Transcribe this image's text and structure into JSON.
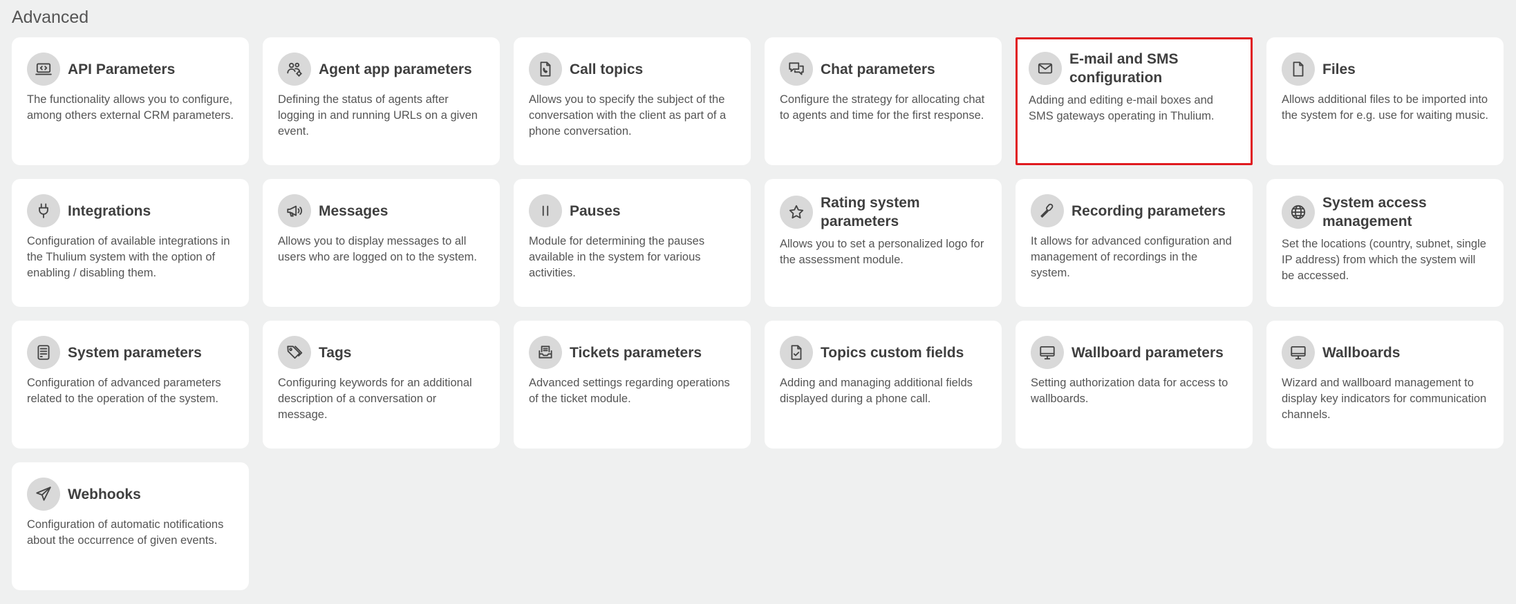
{
  "section": {
    "title": "Advanced"
  },
  "cards": [
    {
      "title": "API Parameters",
      "description": "The functionality allows you to configure, among others external CRM parameters.",
      "icon": "api-icon"
    },
    {
      "title": "Agent app parameters",
      "description": "Defining the status of agents after logging in and running URLs on a given event.",
      "icon": "agents-gear-icon"
    },
    {
      "title": "Call topics",
      "description": "Allows you to specify the subject of the conversation with the client as part of a phone conversation.",
      "icon": "document-phone-icon"
    },
    {
      "title": "Chat parameters",
      "description": "Configure the strategy for allocating chat to agents and time for the first response.",
      "icon": "chat-bubbles-icon"
    },
    {
      "title": "E-mail and SMS configuration",
      "description": "Adding and editing e-mail boxes and SMS gateways operating in Thulium.",
      "icon": "envelope-icon",
      "highlighted": true
    },
    {
      "title": "Files",
      "description": "Allows additional files to be imported into the system for e.g. use for waiting music.",
      "icon": "file-icon"
    },
    {
      "title": "Integrations",
      "description": "Configuration of available integrations in the Thulium system with the option of enabling / disabling them.",
      "icon": "plug-icon"
    },
    {
      "title": "Messages",
      "description": "Allows you to display messages to all users who are logged on to the system.",
      "icon": "megaphone-icon"
    },
    {
      "title": "Pauses",
      "description": "Module for determining the pauses available in the system for various activities.",
      "icon": "pause-icon"
    },
    {
      "title": "Rating system parameters",
      "description": "Allows you to set a personalized logo for the assessment module.",
      "icon": "star-icon"
    },
    {
      "title": "Recording parameters",
      "description": "It allows for advanced configuration and management of recordings in the system.",
      "icon": "microphone-icon"
    },
    {
      "title": "System access management",
      "description": "Set the locations (country, subnet, single IP address) from which the system will be accessed.",
      "icon": "globe-icon"
    },
    {
      "title": "System parameters",
      "description": "Configuration of advanced parameters related to the operation of the system.",
      "icon": "server-icon"
    },
    {
      "title": "Tags",
      "description": "Configuring keywords for an additional description of a conversation or message.",
      "icon": "tags-icon"
    },
    {
      "title": "Tickets parameters",
      "description": "Advanced settings regarding operations of the ticket module.",
      "icon": "ticket-inbox-icon"
    },
    {
      "title": "Topics custom fields",
      "description": "Adding and managing additional fields displayed during a phone call.",
      "icon": "file-check-icon"
    },
    {
      "title": "Wallboard parameters",
      "description": "Setting authorization data for access to wallboards.",
      "icon": "monitor-icon"
    },
    {
      "title": "Wallboards",
      "description": "Wizard and wallboard management to display key indicators for communication channels.",
      "icon": "monitor-icon"
    },
    {
      "title": "Webhooks",
      "description": "Configuration of automatic notifications about the occurrence of given events.",
      "icon": "paper-plane-icon"
    }
  ],
  "colors": {
    "background": "#eff0f0",
    "card": "#ffffff",
    "icon_circle": "#d9d9d9",
    "highlight_border": "#e01a1f"
  }
}
